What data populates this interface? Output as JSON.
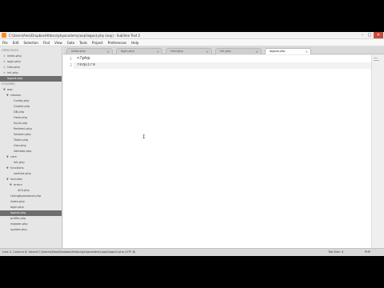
{
  "window": {
    "title": "C:\\Users\\Alex\\Dropbox\\Htdocs\\phpacademy\\oop\\logout.php (oop) - Sublime Text 2",
    "minimize": "–",
    "maximize": "□",
    "close": "✕"
  },
  "menu": [
    "File",
    "Edit",
    "Selection",
    "Find",
    "View",
    "Goto",
    "Tools",
    "Project",
    "Preferences",
    "Help"
  ],
  "sidebar": {
    "open_files_header": "OPEN FILES",
    "open_files": [
      "index.php",
      "login.php",
      "User.php",
      "init.php",
      "logout.php"
    ],
    "folders_header": "FOLDERS",
    "tree": [
      {
        "label": "oop",
        "arrow": "▼"
      },
      {
        "label": "classes",
        "arrow": "▼"
      },
      {
        "label": "Config.php",
        "arrow": ""
      },
      {
        "label": "Cookie.php",
        "arrow": ""
      },
      {
        "label": "DB.php",
        "arrow": ""
      },
      {
        "label": "Hash.php",
        "arrow": ""
      },
      {
        "label": "Input.php",
        "arrow": ""
      },
      {
        "label": "Redirect.php",
        "arrow": ""
      },
      {
        "label": "Session.php",
        "arrow": ""
      },
      {
        "label": "Token.php",
        "arrow": ""
      },
      {
        "label": "User.php",
        "arrow": ""
      },
      {
        "label": "Validate.php",
        "arrow": ""
      },
      {
        "label": "core",
        "arrow": "▼"
      },
      {
        "label": "init.php",
        "arrow": ""
      },
      {
        "label": "functions",
        "arrow": "▼"
      },
      {
        "label": "sanitize.php",
        "arrow": ""
      },
      {
        "label": "includes",
        "arrow": "▼"
      },
      {
        "label": "errors",
        "arrow": "▼"
      },
      {
        "label": "404.php",
        "arrow": ""
      },
      {
        "label": "changepassword.php",
        "arrow": ""
      },
      {
        "label": "index.php",
        "arrow": ""
      },
      {
        "label": "login.php",
        "arrow": ""
      },
      {
        "label": "logout.php",
        "arrow": ""
      },
      {
        "label": "profile.php",
        "arrow": ""
      },
      {
        "label": "register.php",
        "arrow": ""
      },
      {
        "label": "update.php",
        "arrow": ""
      }
    ]
  },
  "tabs": [
    {
      "label": "index.php",
      "close": "×"
    },
    {
      "label": "login.php",
      "close": "×"
    },
    {
      "label": "User.php",
      "close": "×"
    },
    {
      "label": "init.php",
      "close": "×"
    },
    {
      "label": "logout.php",
      "close": "×"
    }
  ],
  "editor": {
    "lines": [
      {
        "number": "1",
        "text": "<?php"
      },
      {
        "number": "2",
        "text": "require"
      }
    ],
    "cursor_glyph": "I"
  },
  "status": {
    "left": "Line 2, Column 8; Saved C:\\Users\\Alex\\Dropbox\\Htdocs\\phpacademy\\oop\\logout.php (UTF-8)",
    "tab_size": "Tab Size: 4",
    "syntax": "PHP"
  }
}
